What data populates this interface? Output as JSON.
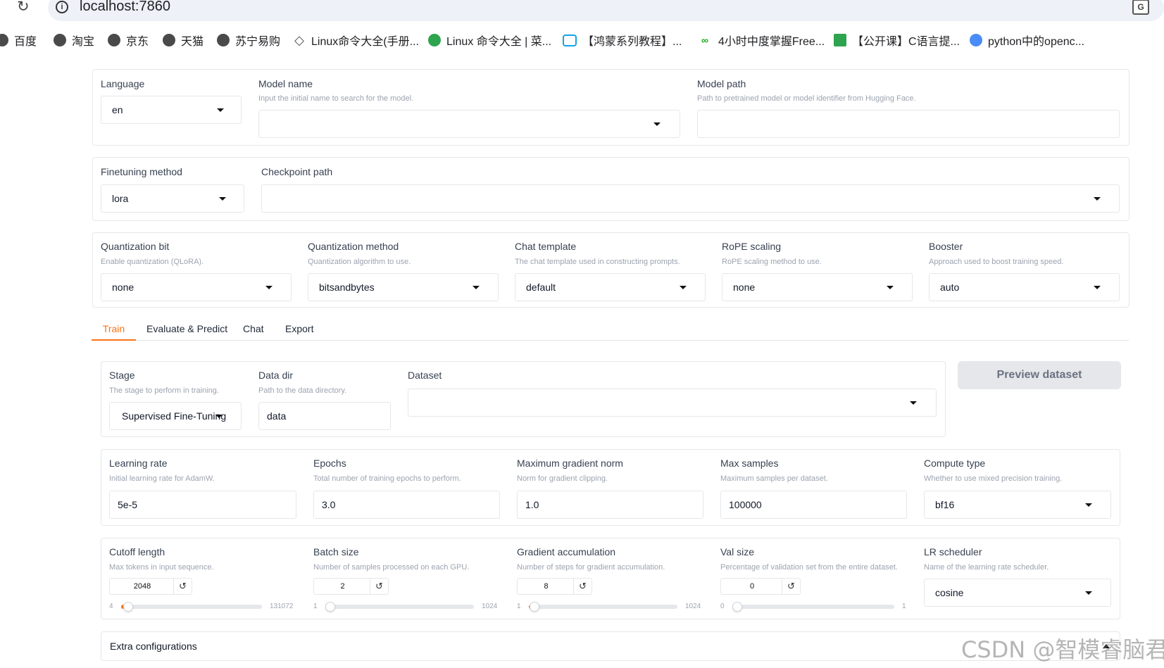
{
  "browser": {
    "url": "localhost:7860",
    "bookmarks": [
      {
        "label": "百度",
        "icon": "globe-icon"
      },
      {
        "label": "淘宝",
        "icon": "globe-icon"
      },
      {
        "label": "京东",
        "icon": "globe-icon"
      },
      {
        "label": "天猫",
        "icon": "globe-icon"
      },
      {
        "label": "苏宁易购",
        "icon": "globe-icon"
      },
      {
        "label": "Linux命令大全(手册...",
        "icon": "diamond-icon"
      },
      {
        "label": "Linux 命令大全 | 菜...",
        "icon": "runoob-icon"
      },
      {
        "label": "【鸿蒙系列教程】...",
        "icon": "bilibili-tv-icon"
      },
      {
        "label": "4小时中度掌握Free...",
        "icon": "loop-icon"
      },
      {
        "label": "【公开课】C语言提...",
        "icon": "green-square-icon"
      },
      {
        "label": "python中的openc...",
        "icon": "csdn-icon"
      }
    ]
  },
  "top": {
    "language": {
      "label": "Language",
      "value": "en"
    },
    "model_name": {
      "label": "Model name",
      "info": "Input the initial name to search for the model.",
      "value": ""
    },
    "model_path": {
      "label": "Model path",
      "info": "Path to pretrained model or model identifier from Hugging Face.",
      "value": ""
    },
    "finetuning_method": {
      "label": "Finetuning method",
      "value": "lora"
    },
    "checkpoint_path": {
      "label": "Checkpoint path",
      "value": ""
    },
    "quantization_bit": {
      "label": "Quantization bit",
      "info": "Enable quantization (QLoRA).",
      "value": "none"
    },
    "quantization_method": {
      "label": "Quantization method",
      "info": "Quantization algorithm to use.",
      "value": "bitsandbytes"
    },
    "chat_template": {
      "label": "Chat template",
      "info": "The chat template used in constructing prompts.",
      "value": "default"
    },
    "rope_scaling": {
      "label": "RoPE scaling",
      "info": "RoPE scaling method to use.",
      "value": "none"
    },
    "booster": {
      "label": "Booster",
      "info": "Approach used to boost training speed.",
      "value": "auto"
    }
  },
  "tabs": [
    "Train",
    "Evaluate & Predict",
    "Chat",
    "Export"
  ],
  "train": {
    "stage": {
      "label": "Stage",
      "info": "The stage to perform in training.",
      "value": "Supervised Fine-Tuning"
    },
    "data_dir": {
      "label": "Data dir",
      "info": "Path to the data directory.",
      "value": "data"
    },
    "dataset": {
      "label": "Dataset",
      "value": ""
    },
    "preview_button": "Preview dataset",
    "learning_rate": {
      "label": "Learning rate",
      "info": "Initial learning rate for AdamW.",
      "value": "5e-5"
    },
    "epochs": {
      "label": "Epochs",
      "info": "Total number of training epochs to perform.",
      "value": "3.0"
    },
    "max_grad_norm": {
      "label": "Maximum gradient norm",
      "info": "Norm for gradient clipping.",
      "value": "1.0"
    },
    "max_samples": {
      "label": "Max samples",
      "info": "Maximum samples per dataset.",
      "value": "100000"
    },
    "compute_type": {
      "label": "Compute type",
      "info": "Whether to use mixed precision training.",
      "value": "bf16"
    },
    "cutoff_length": {
      "label": "Cutoff length",
      "info": "Max tokens in input sequence.",
      "value": "2048",
      "min": "4",
      "max": "131072",
      "fraction": 0.016
    },
    "batch_size": {
      "label": "Batch size",
      "info": "Number of samples processed on each GPU.",
      "value": "2",
      "min": "1",
      "max": "1024",
      "fraction": 0.001
    },
    "grad_accum": {
      "label": "Gradient accumulation",
      "info": "Number of steps for gradient accumulation.",
      "value": "8",
      "min": "1",
      "max": "1024",
      "fraction": 0.007
    },
    "val_size": {
      "label": "Val size",
      "info": "Percentage of validation set from the entire dataset.",
      "value": "0",
      "min": "0",
      "max": "1",
      "fraction": 0.0
    },
    "lr_scheduler": {
      "label": "LR scheduler",
      "info": "Name of the learning rate scheduler.",
      "value": "cosine"
    },
    "extra": "Extra configurations"
  },
  "watermark": "CSDN @智模睿脑君",
  "colors": {
    "accent": "#f97316",
    "border": "#e5e7eb"
  }
}
